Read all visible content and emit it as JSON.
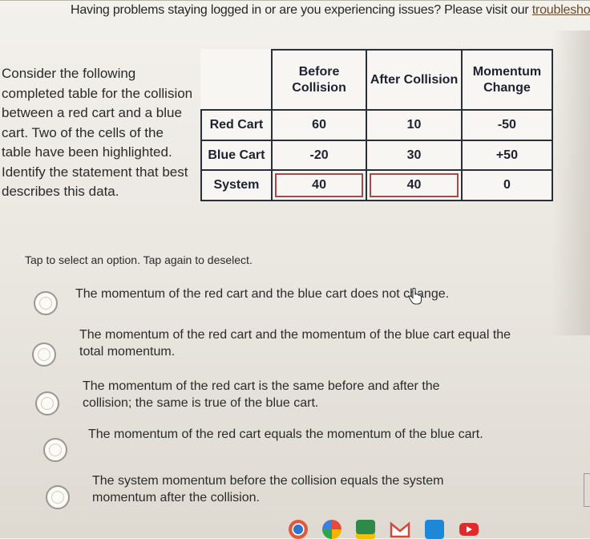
{
  "notice": {
    "text": "Having problems staying logged in or are you experiencing issues? Please visit our ",
    "link": "troubleshooti"
  },
  "prompt": "Consider the following completed table for the collision between a red cart and a blue cart. Two of the cells of the table have been highlighted. Identify the statement that best describes this data.",
  "table": {
    "headers": [
      "Before Collision",
      "After Collision",
      "Momentum Change"
    ],
    "rows": [
      {
        "label": "Red Cart",
        "values": [
          "60",
          "10",
          "-50"
        ]
      },
      {
        "label": "Blue Cart",
        "values": [
          "-20",
          "30",
          "+50"
        ]
      },
      {
        "label": "System",
        "values": [
          "40",
          "40",
          "0"
        ]
      }
    ]
  },
  "instruction": "Tap to select an option. Tap again to deselect.",
  "options": [
    {
      "text": "The momentum of the red cart and the blue cart does not change."
    },
    {
      "text": "The momentum of the red cart and the momentum of the blue cart equal the total momentum."
    },
    {
      "text": "The momentum of the red cart is the same before and after the collision; the same is true of the blue cart."
    },
    {
      "text": "The momentum of the red cart equals the momentum of the blue cart."
    },
    {
      "text": "The system momentum before the collision equals the system momentum after the collision."
    }
  ],
  "icons": {
    "cursor": "hand-pointer-icon",
    "taskbar": [
      "chrome-icon",
      "photos-icon",
      "classroom-icon",
      "gmail-icon",
      "docs-icon",
      "youtube-icon"
    ]
  },
  "colors": {
    "highlight_border": "#a54a4a",
    "table_border": "#2b2f3a",
    "link": "#6b4a2a"
  }
}
